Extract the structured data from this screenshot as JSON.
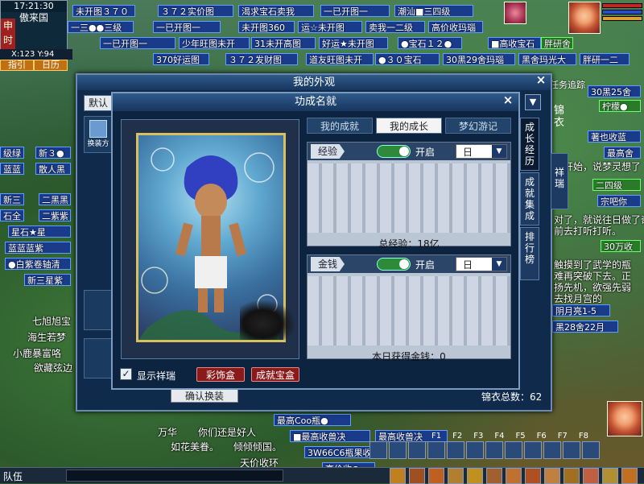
{
  "hud": {
    "time": "17:21:30",
    "location": "傲来国",
    "status_tag": "申时",
    "coords": "X:123 Y:94",
    "btn_guide": "指引",
    "btn_calendar": "日历",
    "team": "队伍"
  },
  "stalls_top": [
    "未开图３７０",
    "３７２实价图",
    "渴求宝石卖我",
    "一已开图一",
    "潮汕■三四级",
    "一三●●三级",
    "一已开图一",
    "未开图360",
    "运☆未开图",
    "卖我一二级",
    "高价收玛瑙",
    "一已开图一",
    "少年旺图未开",
    "31未开高图",
    "好运★未开图",
    "●宝石１２●",
    "■高收宝石",
    "胖研舍",
    "370好运图",
    "３７２发财图",
    "道友旺图未开",
    "●３０宝石",
    "30黑29舍玛瑙",
    "黑舍玛光大",
    "胖研一二"
  ],
  "stalls_left": [
    "级绿",
    "新３●",
    "蓝蓝",
    "散人黑",
    "新三",
    "二黑黑",
    "石全",
    "二紫紫",
    "星石★星",
    "蓝蓝蓝紫",
    "星石★星",
    "●白紫卷轴清",
    "新三星紫"
  ],
  "stalls_right": [
    "任务追踪",
    "30黑25舍",
    "柠檬●",
    "锦衣",
    "著也收蓝",
    "最高舍",
    "二四级",
    "宗吧你",
    "30万收",
    "阴月亮1-5",
    "黑28舍22月",
    "最高Coo瓶●",
    "■最高收兽决",
    "最高收兽决",
    "3W66C6瓶果收",
    "高价收●"
  ],
  "outer_window": {
    "title": "我的外观",
    "tab_default": "默认",
    "btn_confirm": "确认换装",
    "total_label": "锦衣总数：",
    "total_value": "62",
    "side_label": "锦衣",
    "side_tab": "祥瑞",
    "side_btn": "换装方"
  },
  "inner_window": {
    "title": "功成名就",
    "tabs": [
      "我的成就",
      "我的成长",
      "梦幻游记"
    ],
    "active_tab": "我的成长",
    "vtabs": [
      "成长经历",
      "成就集成",
      "排行榜"
    ],
    "sections": [
      {
        "label": "经验",
        "toggle_text": "开启",
        "select_value": "日",
        "footer": "总经验：18亿"
      },
      {
        "label": "金钱",
        "toggle_text": "开启",
        "select_value": "日",
        "footer": "本日获得金钱：0"
      }
    ],
    "show_xiangrui": "显示祥瑞",
    "checkbox_mark": "✓",
    "btn_decor": "彩饰盒",
    "btn_treasure": "成就宝盒"
  },
  "chat": [
    {
      "text": "万华",
      "color": "#ffffff"
    },
    {
      "text": "你们还是好人",
      "color": "#ffffff"
    },
    {
      "text": "如花美眷。",
      "color": "#ffffff"
    },
    {
      "text": "倾倾倾国。",
      "color": "#ffffff"
    },
    {
      "text": "天价收环",
      "color": "#ffffff"
    },
    {
      "text": "小鹿暴富咯",
      "color": "#ffffff"
    },
    {
      "text": "欲藏弦边",
      "color": "#ffffff"
    },
    {
      "text": "海生若梦",
      "color": "#ffffff"
    },
    {
      "text": "七旭旭宝",
      "color": "#ffffff"
    }
  ],
  "right_text": [
    "开始，说梦灵想了",
    "对了，就说往日做了奇怪",
    "前去打听打听。",
    "触摸到了武学的瓶",
    "难再突破下去。正",
    "扬先机，欲强先弱",
    "去找月宫的"
  ],
  "hotkeys": [
    "F1",
    "F2",
    "F3",
    "F4",
    "F5",
    "F6",
    "F7",
    "F8"
  ],
  "colors": {
    "accent": "#2e8a3a",
    "window_bg": "#0d2440",
    "button_red": "#8a1a1a"
  }
}
